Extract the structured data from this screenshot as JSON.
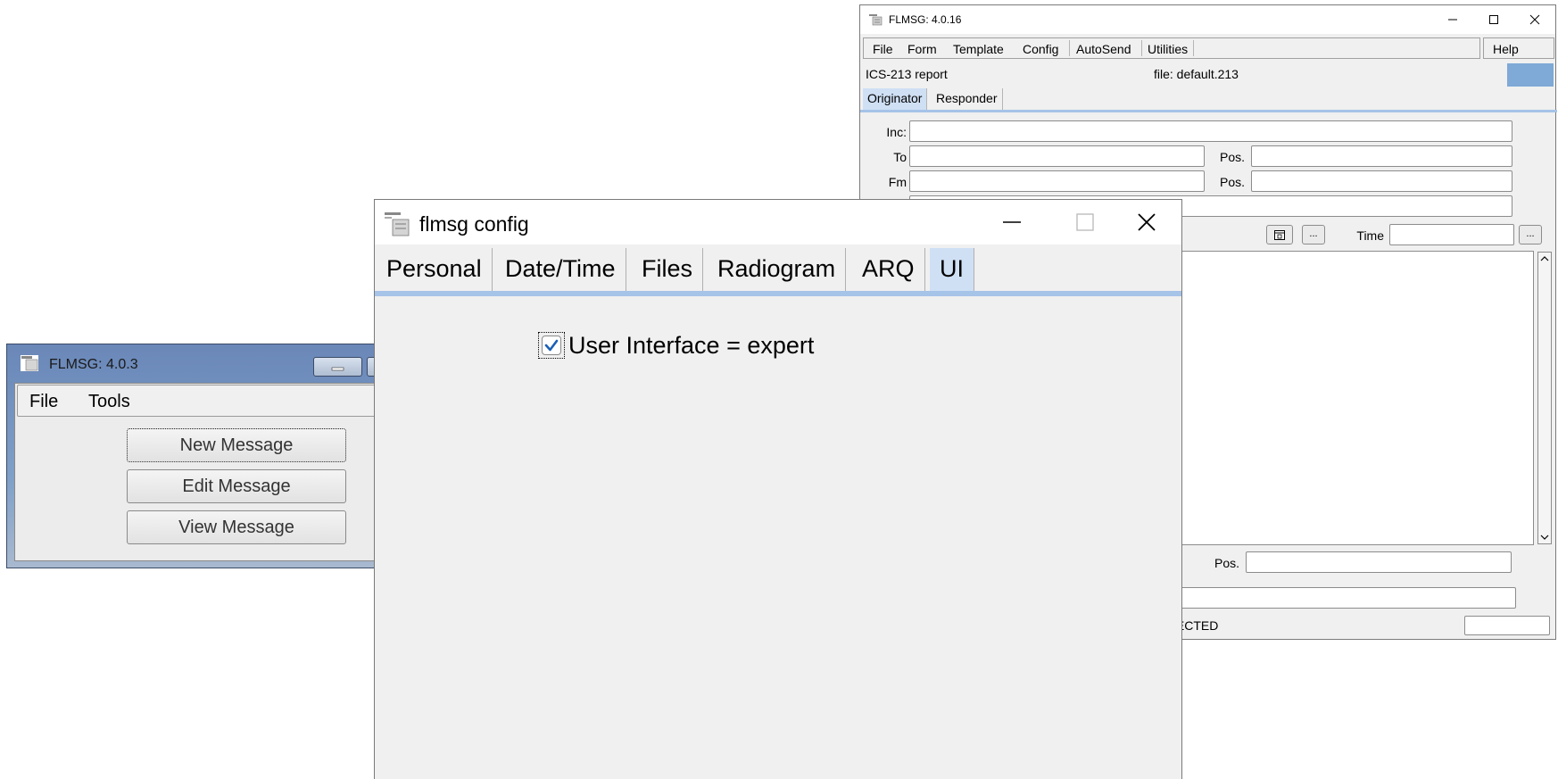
{
  "window_a": {
    "title": "FLMSG: 4.0.16",
    "menu": [
      "File",
      "Form",
      "Template",
      "Config",
      "AutoSend",
      "Utilities"
    ],
    "help": "Help",
    "form_name": "ICS-213 report",
    "file_label": "file: default.213",
    "tabs": [
      "Originator",
      "Responder"
    ],
    "labels": {
      "inc": "Inc:",
      "to": "To",
      "fm": "Fm",
      "pos": "Pos.",
      "time": "Time"
    },
    "ellipsis": "...",
    "status_text": "IECTED"
  },
  "window_b": {
    "title": "FLMSG: 4.0.3",
    "menu": [
      "File",
      "Tools"
    ],
    "buttons": [
      "New Message",
      "Edit Message",
      "View Message"
    ]
  },
  "window_c": {
    "title": "flmsg config",
    "tabs": [
      "Personal",
      "Date/Time",
      "Files",
      "Radiogram",
      "ARQ",
      "UI"
    ],
    "active_tab": "UI",
    "checkbox_label": "User Interface = expert",
    "checkbox_checked": true
  },
  "colors": {
    "tab_accent": "#a6c3e8",
    "active_tab": "#cfe0f5",
    "check": "#1a5fb4",
    "status_blue": "#7fa9d6"
  }
}
